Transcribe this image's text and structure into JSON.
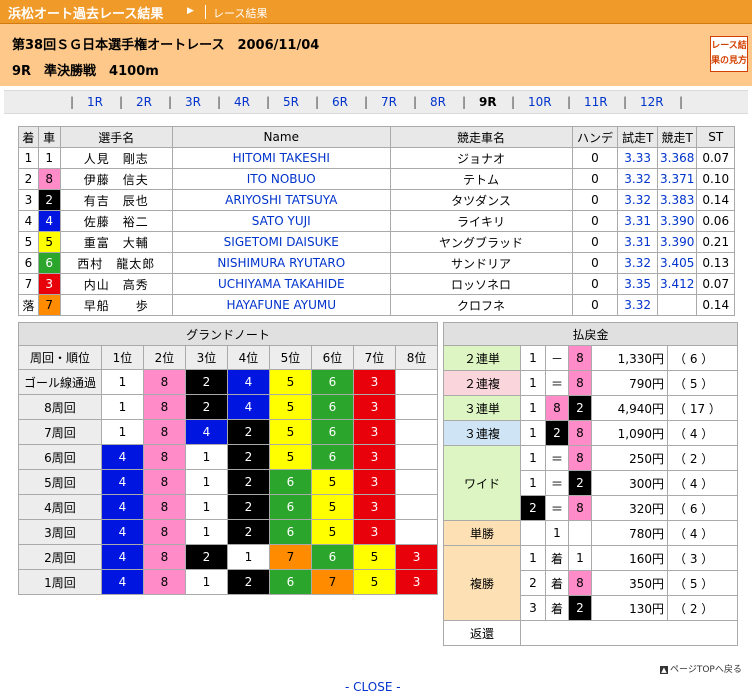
{
  "header": {
    "site_title": "浜松オート過去レース結果",
    "breadcrumb_current": "レース結果",
    "race_title": "第38回ＳＧ日本選手権オートレース　2006/11/04",
    "race_subtitle": "9R　準決勝戦　4100m",
    "guide_button": "レース結果の見方"
  },
  "race_nav": {
    "items": [
      "1R",
      "2R",
      "3R",
      "4R",
      "5R",
      "6R",
      "7R",
      "8R",
      "9R",
      "10R",
      "11R",
      "12R"
    ],
    "current": "9R"
  },
  "results": {
    "columns": [
      "着",
      "車",
      "選手名",
      "Name",
      "競走車名",
      "ハンデ",
      "試走T",
      "競走T",
      "ST"
    ],
    "rows": [
      {
        "rank": "1",
        "car": "1",
        "name": "人見　剛志",
        "name_en": "HITOMI TAKESHI",
        "bike": "ジョナオ",
        "handicap": "0",
        "trial": "3.33",
        "race_time": "3.368",
        "st": "0.07"
      },
      {
        "rank": "2",
        "car": "8",
        "name": "伊藤　信夫",
        "name_en": "ITO NOBUO",
        "bike": "テトム",
        "handicap": "0",
        "trial": "3.32",
        "race_time": "3.371",
        "st": "0.10"
      },
      {
        "rank": "3",
        "car": "2",
        "name": "有吉　辰也",
        "name_en": "ARIYOSHI TATSUYA",
        "bike": "タツダンス",
        "handicap": "0",
        "trial": "3.32",
        "race_time": "3.383",
        "st": "0.14"
      },
      {
        "rank": "4",
        "car": "4",
        "name": "佐藤　裕二",
        "name_en": "SATO YUJI",
        "bike": "ライキリ",
        "handicap": "0",
        "trial": "3.31",
        "race_time": "3.390",
        "st": "0.06"
      },
      {
        "rank": "5",
        "car": "5",
        "name": "重富　大輔",
        "name_en": "SIGETOMI DAISUKE",
        "bike": "ヤングブラッド",
        "handicap": "0",
        "trial": "3.31",
        "race_time": "3.390",
        "st": "0.21"
      },
      {
        "rank": "6",
        "car": "6",
        "name": "西村　龍太郎",
        "name_en": "NISHIMURA RYUTARO",
        "bike": "サンドリア",
        "handicap": "0",
        "trial": "3.32",
        "race_time": "3.405",
        "st": "0.13"
      },
      {
        "rank": "7",
        "car": "3",
        "name": "内山　高秀",
        "name_en": "UCHIYAMA TAKAHIDE",
        "bike": "ロッソネロ",
        "handicap": "0",
        "trial": "3.35",
        "race_time": "3.412",
        "st": "0.07"
      },
      {
        "rank": "落",
        "car": "7",
        "name": "早船　　歩",
        "name_en": "HAYAFUNE AYUMU",
        "bike": "クロフネ",
        "handicap": "0",
        "trial": "3.32",
        "race_time": "",
        "st": "0.14"
      }
    ]
  },
  "grand_note": {
    "title": "グランドノート",
    "columns": [
      "周回・順位",
      "1位",
      "2位",
      "3位",
      "4位",
      "5位",
      "6位",
      "7位",
      "8位"
    ],
    "rows": [
      {
        "lap": "ゴール線通過",
        "order": [
          "1",
          "8",
          "2",
          "4",
          "5",
          "6",
          "3",
          ""
        ]
      },
      {
        "lap": "8周回",
        "order": [
          "1",
          "8",
          "2",
          "4",
          "5",
          "6",
          "3",
          ""
        ]
      },
      {
        "lap": "7周回",
        "order": [
          "1",
          "8",
          "4",
          "2",
          "5",
          "6",
          "3",
          ""
        ]
      },
      {
        "lap": "6周回",
        "order": [
          "4",
          "8",
          "1",
          "2",
          "5",
          "6",
          "3",
          ""
        ]
      },
      {
        "lap": "5周回",
        "order": [
          "4",
          "8",
          "1",
          "2",
          "6",
          "5",
          "3",
          ""
        ]
      },
      {
        "lap": "4周回",
        "order": [
          "4",
          "8",
          "1",
          "2",
          "6",
          "5",
          "3",
          ""
        ]
      },
      {
        "lap": "3周回",
        "order": [
          "4",
          "8",
          "1",
          "2",
          "6",
          "5",
          "3",
          ""
        ]
      },
      {
        "lap": "2周回",
        "order": [
          "4",
          "8",
          "2",
          "1",
          "7",
          "6",
          "5",
          "3"
        ]
      },
      {
        "lap": "1周回",
        "order": [
          "4",
          "8",
          "1",
          "2",
          "6",
          "7",
          "5",
          "3"
        ]
      }
    ]
  },
  "payout": {
    "title": "払戻金",
    "nirentan": {
      "label": "２連単",
      "a": "1",
      "sym": "－",
      "b": "8",
      "amount": "1,330円",
      "pop": "（ 6 ）"
    },
    "nirenfuku": {
      "label": "２連複",
      "a": "1",
      "sym": "＝",
      "b": "8",
      "amount": "790円",
      "pop": "（ 5 ）"
    },
    "sanrentan": {
      "label": "３連単",
      "a": "1",
      "b": "8",
      "c": "2",
      "amount": "4,940円",
      "pop": "（ 17 ）"
    },
    "sanrenfuku": {
      "label": "３連複",
      "a": "1",
      "b": "2",
      "c": "8",
      "amount": "1,090円",
      "pop": "（ 4 ）"
    },
    "wide": {
      "label": "ワイド",
      "rows": [
        {
          "a": "1",
          "sym": "＝",
          "b": "8",
          "amount": "250円",
          "pop": "（ 2 ）"
        },
        {
          "a": "1",
          "sym": "＝",
          "b": "2",
          "amount": "300円",
          "pop": "（ 4 ）"
        },
        {
          "a": "2",
          "sym": "＝",
          "b": "8",
          "amount": "320円",
          "pop": "（ 6 ）"
        }
      ]
    },
    "tansho": {
      "label": "単勝",
      "car": "1",
      "amount": "780円",
      "pop": "（ 4 ）"
    },
    "fukusho": {
      "label": "複勝",
      "rows": [
        {
          "rank": "1",
          "chaku": "着",
          "car": "1",
          "amount": "160円",
          "pop": "（ 3 ）"
        },
        {
          "rank": "2",
          "chaku": "着",
          "car": "8",
          "amount": "350円",
          "pop": "（ 5 ）"
        },
        {
          "rank": "3",
          "chaku": "着",
          "car": "2",
          "amount": "130円",
          "pop": "（ 2 ）"
        }
      ]
    },
    "henkan": {
      "label": "返還"
    }
  },
  "footer": {
    "page_top": "ページTOPへ戻る",
    "close": "- CLOSE -"
  },
  "colors": {
    "header_orange": "#f09a2a",
    "header_light": "#fdc88a",
    "car_1": "#ffffff",
    "car_2": "#000000",
    "car_3": "#e8000b",
    "car_4": "#0016e0",
    "car_5": "#ffff00",
    "car_6": "#2ba52b",
    "car_7": "#ff8c00",
    "car_8": "#ff8bc8"
  }
}
